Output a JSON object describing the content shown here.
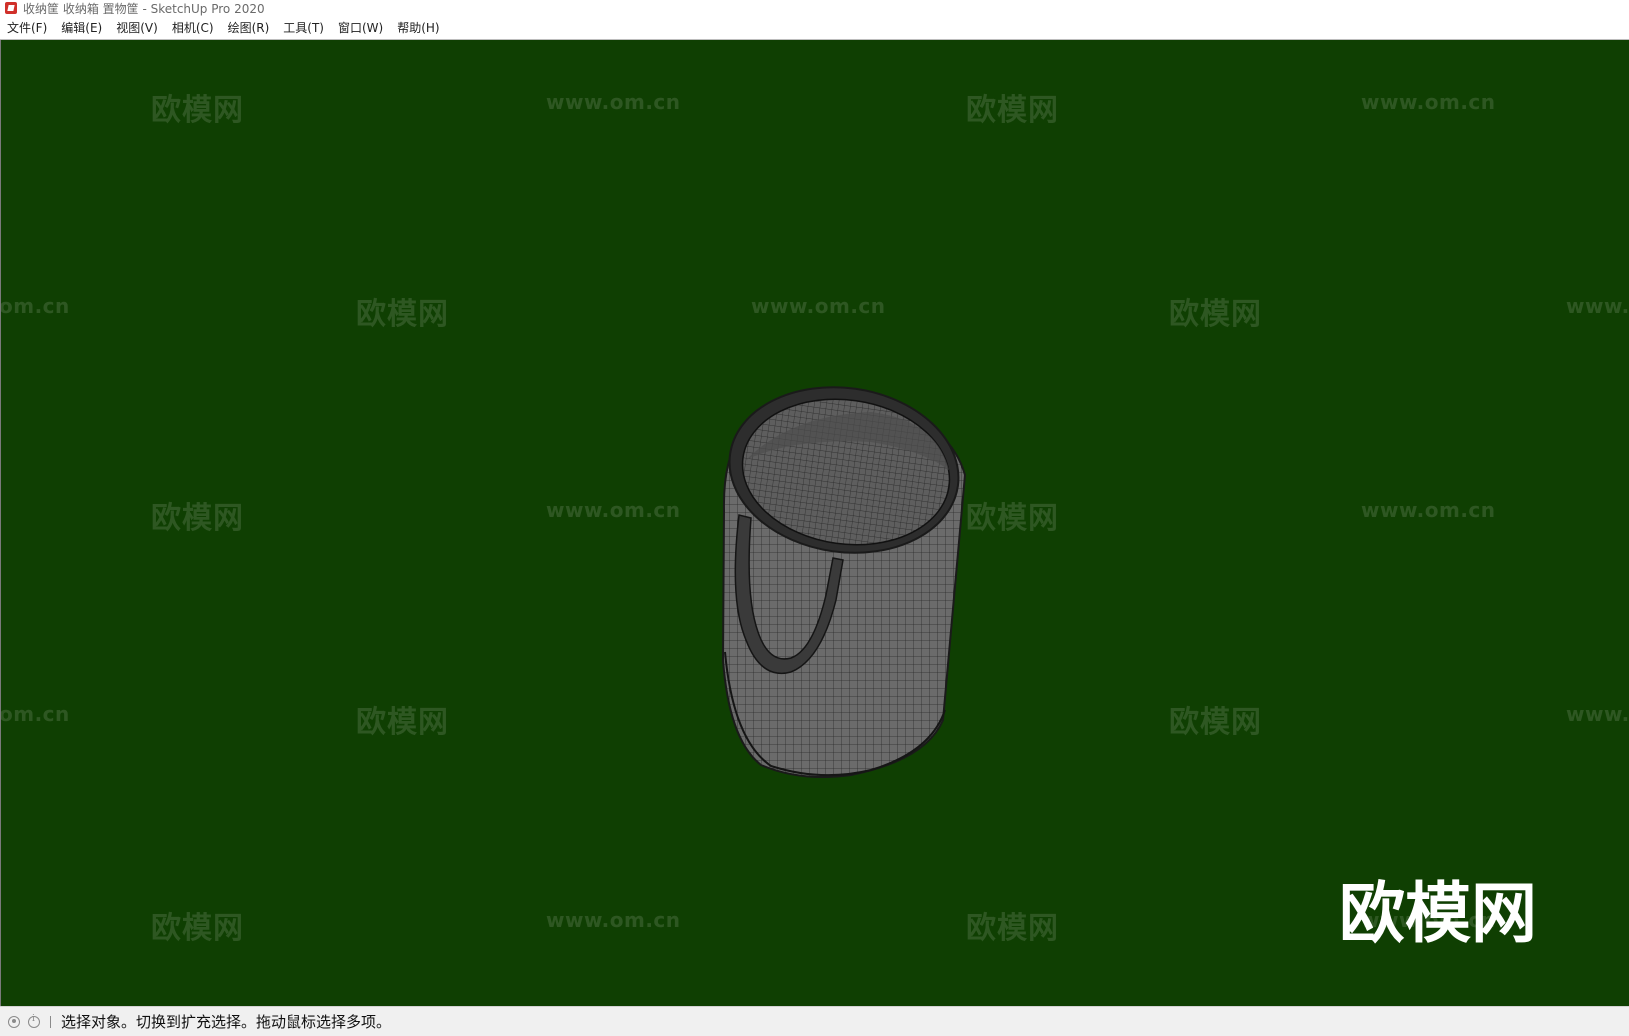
{
  "window": {
    "title": "收纳筐 收纳箱 置物筐 - SketchUp Pro 2020"
  },
  "menu": {
    "items": [
      {
        "label": "文件(F)"
      },
      {
        "label": "编辑(E)"
      },
      {
        "label": "视图(V)"
      },
      {
        "label": "相机(C)"
      },
      {
        "label": "绘图(R)"
      },
      {
        "label": "工具(T)"
      },
      {
        "label": "窗口(W)"
      },
      {
        "label": "帮助(H)"
      }
    ]
  },
  "viewport": {
    "background_color": "#0f3f02",
    "model_description": "basket-model",
    "watermark_logo": "欧模网",
    "watermarks": [
      "欧模网",
      "www.om.cn",
      "欧模网",
      "www.om.cn",
      "om.cn",
      "欧模网",
      "www.om.cn",
      "欧模网",
      "www.",
      "欧模网",
      "www.om.cn",
      "欧模网",
      "www.om.cn",
      "om.cn",
      "欧模网",
      "欧模网",
      "www.",
      "欧模网",
      "www.om.cn",
      "欧模网",
      "www.om.cn"
    ]
  },
  "status": {
    "icons": [
      "geolocation-icon",
      "info-icon"
    ],
    "text": "选择对象。切换到扩充选择。拖动鼠标选择多项。"
  }
}
